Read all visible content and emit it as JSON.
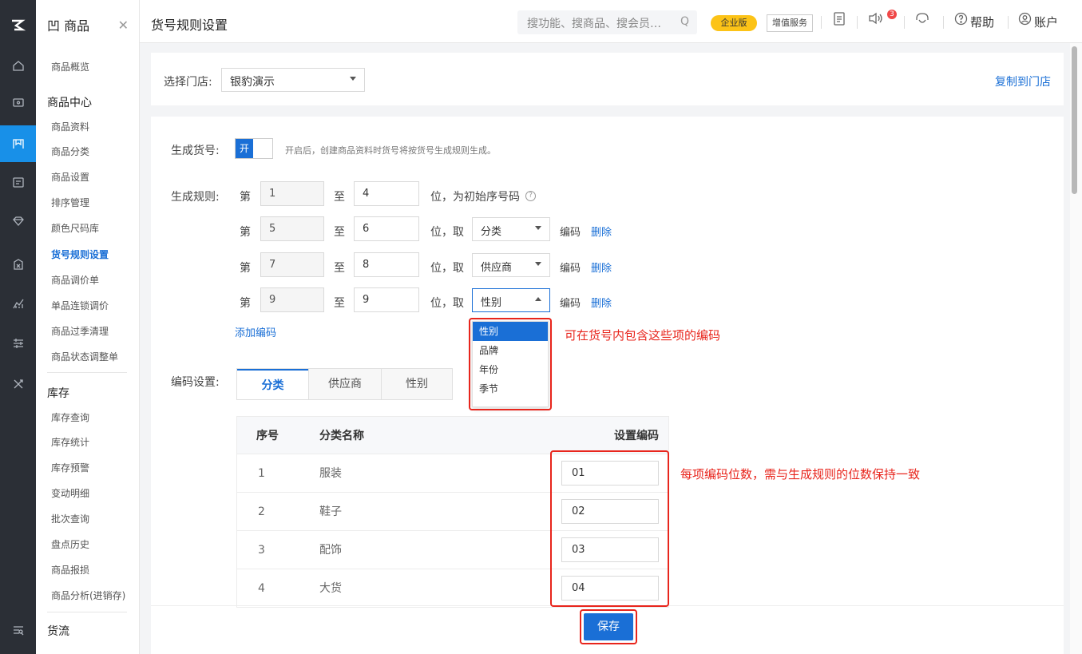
{
  "rail": {
    "icons": [
      "logo-icon",
      "home-icon",
      "wallet-icon",
      "goods-icon",
      "member-card-icon",
      "diamond-icon",
      "stats-icon",
      "chart-icon",
      "filter-icon",
      "tools-icon",
      "bottom-list-icon"
    ]
  },
  "nav": {
    "header": "凹 商品",
    "items": [
      "商品概览",
      "商品中心",
      "商品资料",
      "商品分类",
      "商品设置",
      "排序管理",
      "颜色尺码库",
      "货号规则设置",
      "商品调价单",
      "单品连锁调价",
      "商品过季清理",
      "商品状态调整单",
      "库存",
      "库存查询",
      "库存统计",
      "库存预警",
      "变动明细",
      "批次查询",
      "盘点历史",
      "商品报损",
      "商品分析(进销存)",
      "货流"
    ],
    "active": "货号规则设置"
  },
  "topbar": {
    "title": "货号规则设置",
    "search_placeholder": "搜功能、搜商品、搜会员…",
    "edition_badge": "企业版",
    "value_service": "增值服务",
    "notice_count": "3",
    "help": "帮助",
    "account": "账户"
  },
  "store": {
    "label": "选择门店:",
    "value": "银豹演示",
    "copy_link": "复制到门店"
  },
  "generate": {
    "label": "生成货号:",
    "toggle": "开",
    "hint": "开启后，创建商品资料时货号将按货号生成规则生成。"
  },
  "rules": {
    "label": "生成规则:",
    "di": "第",
    "zhi": "至",
    "first": {
      "from": "1",
      "to": "4",
      "suffix": "位，为初始序号码"
    },
    "rows": [
      {
        "from": "5",
        "to": "6",
        "take": "位，取",
        "option": "分类",
        "code": "编码",
        "delete": "删除"
      },
      {
        "from": "7",
        "to": "8",
        "take": "位，取",
        "option": "供应商",
        "code": "编码",
        "delete": "删除"
      },
      {
        "from": "9",
        "to": "9",
        "take": "位，取",
        "option": "性别",
        "code": "编码",
        "delete": "删除"
      }
    ],
    "add": "添加编码"
  },
  "dropdown": {
    "options": [
      "性别",
      "品牌",
      "年份",
      "季节"
    ],
    "selected": "性别"
  },
  "annotations": {
    "dropdown_note": "可在货号内包含这些项的编码",
    "code_note": "每项编码位数，需与生成规则的位数保持一致"
  },
  "code_settings": {
    "label": "编码设置:",
    "tabs": [
      "分类",
      "供应商",
      "性别"
    ],
    "active_tab": "分类",
    "columns": [
      "序号",
      "分类名称",
      "设置编码"
    ],
    "rows": [
      {
        "no": "1",
        "name": "服装",
        "code": "01"
      },
      {
        "no": "2",
        "name": "鞋子",
        "code": "02"
      },
      {
        "no": "3",
        "name": "配饰",
        "code": "03"
      },
      {
        "no": "4",
        "name": "大货",
        "code": "04"
      }
    ]
  },
  "save_label": "保存",
  "colors": {
    "primary": "#1a6fd6",
    "annotation": "#e8251c",
    "badge": "#fcc317",
    "rail": "#2b2f36"
  }
}
